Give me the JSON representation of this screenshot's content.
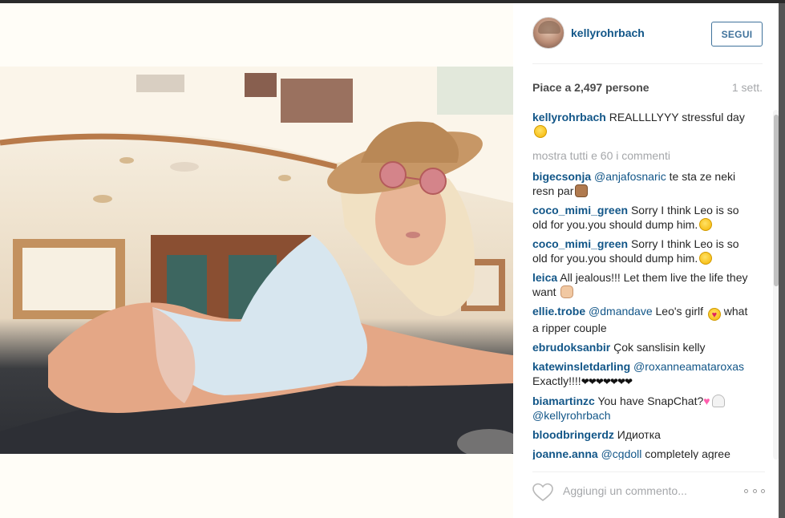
{
  "post": {
    "username": "kellyrohrbach",
    "follow_label": "SEGUI",
    "likes_text": "Piace a 2,497 persone",
    "time_ago": "1 sett.",
    "caption_user": "kellyrohrbach",
    "caption_text": "REALLLLYYY stressful day",
    "view_all_comments": "mostra tutti e 60 i commenti",
    "add_comment_placeholder": "Aggiungi un commento..."
  },
  "comments": [
    {
      "user": "bigecsonja",
      "mention": "@anjafosnaric",
      "text": " te sta ze neki resn par",
      "emoji": "monkey-emoji"
    },
    {
      "user": "coco_mimi_green",
      "mention": "",
      "text": "Sorry I think Leo is so old for you.you should dump him.",
      "emoji": "unamused-emoji"
    },
    {
      "user": "coco_mimi_green",
      "mention": "",
      "text": "Sorry I think Leo is so old for you.you should dump him.",
      "emoji": "unamused-emoji"
    },
    {
      "user": "leica",
      "mention": "",
      "text": "All jealous!!! Let them live the life they want",
      "emoji": "ok-hand-emoji"
    },
    {
      "user": "ellie.trobe",
      "mention": "@dmandave",
      "text": " Leo's girlf",
      "emoji": "heart-eyes-emoji",
      "text_after": " what a ripper couple"
    },
    {
      "user": "ebrudoksanbir",
      "mention": "",
      "text": "Çok sanslisin kelly",
      "emoji": ""
    },
    {
      "user": "katewinsletdarling",
      "mention": "@roxanneamataroxas",
      "text": " Exactly!!!!",
      "emoji": "black-hearts",
      "hearts": "❤❤❤❤❤❤❤"
    },
    {
      "user": "biamartinzc",
      "mention": "",
      "text": "You have SnapChat?",
      "emoji": "pink-heart-ghost",
      "mention_after": "@kellyrohrbach"
    },
    {
      "user": "bloodbringerdz",
      "mention": "",
      "text": "Идиотка",
      "emoji": ""
    },
    {
      "user": "joanne.anna",
      "mention": "@cgdoll",
      "text": " completely agree",
      "emoji": ""
    }
  ],
  "colors": {
    "link": "#125688",
    "muted": "#a5a7aa",
    "button_border": "#3f729b"
  },
  "icons": [
    "heart-icon",
    "more-options-icon",
    "avatar"
  ]
}
